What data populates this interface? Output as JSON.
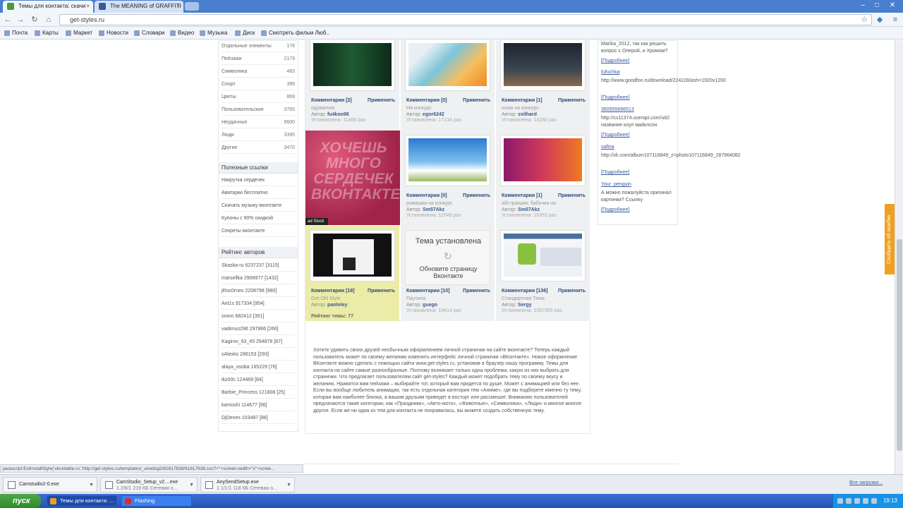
{
  "browser": {
    "tabs": [
      {
        "label": "Темы для контакта: скачи",
        "active": true,
        "color": "#4a9a3a"
      },
      {
        "label": "The MEANING of GRAFFITI",
        "active": false,
        "color": "#3b5998"
      }
    ],
    "url": "get-styles.ru",
    "bookmarks": [
      "Почта",
      "Карты",
      "Маркет",
      "Новости",
      "Словари",
      "Видео",
      "Музыка",
      "Диск",
      "Смотреть фильм Люб.."
    ]
  },
  "sidebar": {
    "categories": [
      {
        "name": "Отдельные элементы",
        "count": "178"
      },
      {
        "name": "Пейзажи",
        "count": "2179"
      },
      {
        "name": "Символика",
        "count": "483"
      },
      {
        "name": "Спорт",
        "count": "396"
      },
      {
        "name": "Цветы",
        "count": "869"
      },
      {
        "name": "Пользовательские",
        "count": "3765"
      },
      {
        "name": "Неудачные",
        "count": "9600"
      },
      {
        "name": "Люди",
        "count": "3395"
      },
      {
        "name": "Другие",
        "count": "3470"
      }
    ],
    "useful_title": "Полезные ссылки",
    "useful_links": [
      "Накрутка сердечек",
      "Аватарки бесплатно",
      "Скачать музыку вконтакте",
      "Купоны с 90% скидкой",
      "Секреты вконтакте"
    ],
    "rating_title": "Рейтинг авторов",
    "authors": [
      "Skaska-ru 6237237 [3115]",
      "marsellka 2908977 [1432]",
      "jRoc0rnev 2208798 [980]",
      "Ant1s 917334 [954]",
      "sronn 682412 [351]",
      "vadimus296 297866 [266]",
      "Kagirov_93_45 294878 [87]",
      "sAlexks 286153 [293]",
      "alaya_osoba 165229 [76]",
      "ikz00c 124469 [84]",
      "Barbie_Princess 121808 [25]",
      "kamoshi 114677 [96]",
      "DjDenes 103487 [88]"
    ]
  },
  "cards": [
    {
      "comments": "Комментарии [2]",
      "apply": "Применить",
      "category": "одуванчик",
      "author_label": "Автор:",
      "author": "fu4koo96",
      "installs": "Установлена: 11466 раз"
    },
    {
      "comments": "Комментарии [0]",
      "apply": "Применить",
      "category": "На конкурс",
      "author_label": "Автор:",
      "author": "egor6242",
      "installs": "Установлена: 17134 раз"
    },
    {
      "comments": "Комментарии [1]",
      "apply": "Применить",
      "category": "шоки на конкурс",
      "author_label": "Автор:",
      "author": "svilhard",
      "installs": "Установлена: 14280 раз"
    },
    {
      "comments": "Комментарии [0]",
      "apply": "Применить",
      "category": "ромашки на конкурс",
      "author_label": "Автор:",
      "author": "Sm57Akz",
      "installs": "Установлена: 11549 раз"
    },
    {
      "comments": "Комментарии [1]",
      "apply": "Применить",
      "category": "абстракция, бабочка на",
      "author_label": "Автор:",
      "author": "Sm57Akz",
      "installs": "Установлена: 16353 раз"
    },
    {
      "comments": "Комментарии [19]",
      "apply": "Применить",
      "category": "Get Old Style",
      "author_label": "Автор:",
      "author": "panteley",
      "rating": "Рейтинг темы: 77"
    },
    {
      "comments": "Комментарии [10]",
      "apply": "Применить",
      "category": "Паутина",
      "author_label": "Автор:",
      "author": "guego",
      "installs": "Установлена: 18414 раз"
    },
    {
      "comments": "Комментарии [136]",
      "apply": "Применить",
      "category": "Стандартная Тема",
      "author_label": "Автор:",
      "author": "Sergy",
      "installs": "Установлена: 1067389 раз"
    }
  ],
  "hearts_banner": {
    "text": "ХОЧЕШЬ МНОГО СЕРДЕЧЕК ВКОНТАКТЕ?",
    "badge": "ad Stock"
  },
  "installed_overlay": {
    "title": "Тема установлена",
    "subtitle": "Обновите страницу Вконтакте"
  },
  "description": "Хотите удивить своих друзей необычным оформлением личной странички на сайте вконтакте? Теперь каждый пользователь может по своему желанию изменить интерфейс личной странички «ВКонтакте». Новое оформление ВКонтакте можно сделать с помощью сайта www.get-styles.ru, установив в браузер нашу программу. Темы для контакта на сайте самые разнообразные. Поэтому возникает только одна проблема, какую из них выбрать для странички. Что предлагает пользователям сайт get-styles? Каждый может подобрать тему по своему вкусу и желанию. Нравятся вам пейзажи – выбирайте тот, который вам придется по душе. Может с анимацией или без нее. Если вы вообще любитель анимации, так есть отдельная категория тем «Аниме», где вы подберете именно ту тему, которая вам наиболее близка, а вашим друзьям приведет в восторг или рассмешит. Вниманию пользователей предлагаются такие категории, как «Праздники», «Авто-мото», «Животные», «Символика», «Люди» и многое многое другое. Если же ни одна из тем для контакта не понравилась, вы можете создать собственную тему.",
  "comments_panel": [
    {
      "type": "text",
      "text": "Marika_2012, так как решить вопрос с Оперой, и Хромом?"
    },
    {
      "type": "more",
      "text": "[Подробнее]"
    },
    {
      "type": "user",
      "text": "fufuchka"
    },
    {
      "type": "text",
      "text": "http://www.goodfon.ru/download/224228/ash=1920x1200"
    },
    {
      "type": "more",
      "text": "[Подробнее]"
    },
    {
      "type": "user",
      "text": "360955696513"
    },
    {
      "type": "text",
      "text": "http://cs11374.userapi.com/u82 название коул майклсон"
    },
    {
      "type": "more",
      "text": "[Подробнее]"
    },
    {
      "type": "user",
      "text": "safina"
    },
    {
      "type": "text",
      "text": "http://vk.com/album107116849_z=photo107116849_287964082"
    },
    {
      "type": "more",
      "text": "[Подробнее]"
    },
    {
      "type": "user",
      "text": "Your_penguin"
    },
    {
      "type": "text",
      "text": "А можно пожалуйста оригинал картинки? Ссылку"
    },
    {
      "type": "more",
      "text": "[Подробнее]"
    }
  ],
  "feedback_tab": "Сообщить об ошибке",
  "status_url": "javascript:ExtInstallStyle('vkontakte.ru','http://get-styles.ru/templates/_unedog2/81817638/81817638.css?+\"+screen.width+\"x\"+scree...",
  "downloads": [
    {
      "name": "Camstudio2-0.exe",
      "status": ""
    },
    {
      "name": "CamStudio_Setup_v2....exe",
      "status": "1.2/6/1 219 КБ Сетевая о..."
    },
    {
      "name": "AnySendSetup.exe",
      "status": "1.1/1/1 118 КБ Сетевая о..."
    }
  ],
  "all_downloads": "Все загрузки...",
  "taskbar": {
    "start": "пуск",
    "tasks": [
      {
        "label": "Темы для контакта: ...",
        "active": true
      },
      {
        "label": "Flashing",
        "active": false
      }
    ],
    "clock": "19:13"
  }
}
